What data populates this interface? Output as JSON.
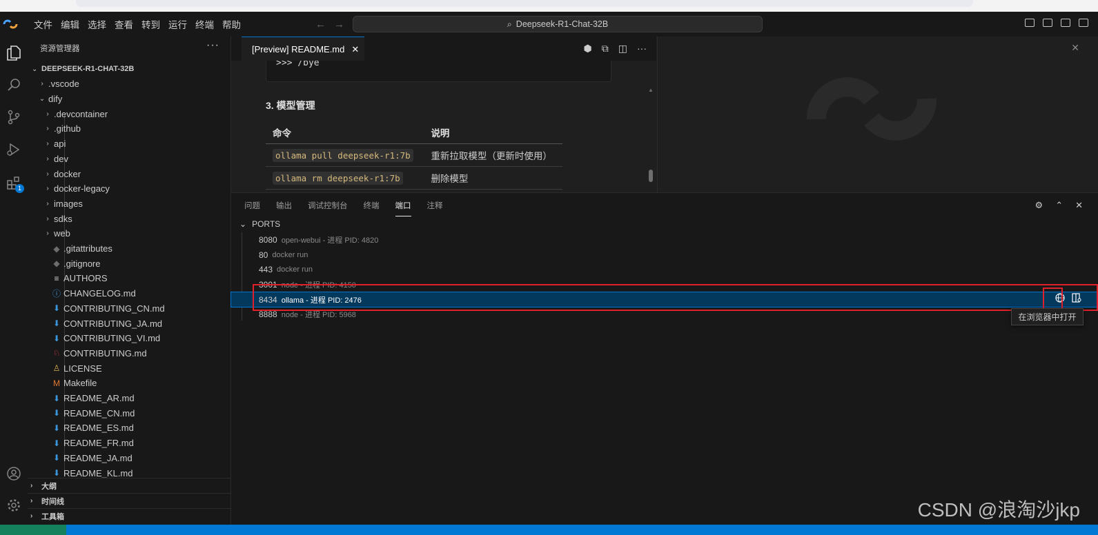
{
  "titlebar": {
    "menus": [
      "文件",
      "编辑",
      "选择",
      "查看",
      "转到",
      "运行",
      "终端",
      "帮助"
    ],
    "search_text": "Deepseek-R1-Chat-32B"
  },
  "activitybar": {
    "items": [
      "explorer-icon",
      "search-icon",
      "source-control-icon",
      "run-debug-icon",
      "extensions-icon"
    ],
    "extensions_badge": "1",
    "bottom": [
      "account-icon",
      "settings-gear-icon"
    ]
  },
  "sidebar": {
    "title": "资源管理器",
    "more": "···",
    "workspace": "DEEPSEEK-R1-CHAT-32B",
    "tree": [
      {
        "label": ".vscode",
        "chev": "›",
        "indent": 1,
        "icon": ""
      },
      {
        "label": "dify",
        "chev": "⌄",
        "indent": 1,
        "icon": ""
      },
      {
        "label": ".devcontainer",
        "chev": "›",
        "indent": 2,
        "icon": ""
      },
      {
        "label": ".github",
        "chev": "›",
        "indent": 2,
        "icon": ""
      },
      {
        "label": "api",
        "chev": "›",
        "indent": 2,
        "icon": ""
      },
      {
        "label": "dev",
        "chev": "›",
        "indent": 2,
        "icon": ""
      },
      {
        "label": "docker",
        "chev": "›",
        "indent": 2,
        "icon": ""
      },
      {
        "label": "docker-legacy",
        "chev": "›",
        "indent": 2,
        "icon": ""
      },
      {
        "label": "images",
        "chev": "›",
        "indent": 2,
        "icon": ""
      },
      {
        "label": "sdks",
        "chev": "›",
        "indent": 2,
        "icon": ""
      },
      {
        "label": "web",
        "chev": "›",
        "indent": 2,
        "icon": ""
      },
      {
        "label": ".gitattributes",
        "chev": "",
        "indent": 2,
        "icon": "◆",
        "color": "#6d6d6d"
      },
      {
        "label": ".gitignore",
        "chev": "",
        "indent": 2,
        "icon": "◆",
        "color": "#6d6d6d"
      },
      {
        "label": "AUTHORS",
        "chev": "",
        "indent": 2,
        "icon": "≡",
        "color": "#cccccc"
      },
      {
        "label": "CHANGELOG.md",
        "chev": "",
        "indent": 2,
        "icon": "ⓘ",
        "color": "#3a96dd"
      },
      {
        "label": "CONTRIBUTING_CN.md",
        "chev": "",
        "indent": 2,
        "icon": "⬇",
        "color": "#3a96dd"
      },
      {
        "label": "CONTRIBUTING_JA.md",
        "chev": "",
        "indent": 2,
        "icon": "⬇",
        "color": "#3a96dd"
      },
      {
        "label": "CONTRIBUTING_VI.md",
        "chev": "",
        "indent": 2,
        "icon": "⬇",
        "color": "#3a96dd"
      },
      {
        "label": "CONTRIBUTING.md",
        "chev": "",
        "indent": 2,
        "icon": "♘",
        "color": "#e0434b"
      },
      {
        "label": "LICENSE",
        "chev": "",
        "indent": 2,
        "icon": "♙",
        "color": "#d8b04c"
      },
      {
        "label": "Makefile",
        "chev": "",
        "indent": 2,
        "icon": "M",
        "color": "#e37933"
      },
      {
        "label": "README_AR.md",
        "chev": "",
        "indent": 2,
        "icon": "⬇",
        "color": "#3a96dd"
      },
      {
        "label": "README_CN.md",
        "chev": "",
        "indent": 2,
        "icon": "⬇",
        "color": "#3a96dd"
      },
      {
        "label": "README_ES.md",
        "chev": "",
        "indent": 2,
        "icon": "⬇",
        "color": "#3a96dd"
      },
      {
        "label": "README_FR.md",
        "chev": "",
        "indent": 2,
        "icon": "⬇",
        "color": "#3a96dd"
      },
      {
        "label": "README_JA.md",
        "chev": "",
        "indent": 2,
        "icon": "⬇",
        "color": "#3a96dd"
      },
      {
        "label": "README_KL.md",
        "chev": "",
        "indent": 2,
        "icon": "⬇",
        "color": "#3a96dd"
      }
    ],
    "sections": [
      "大纲",
      "时间线",
      "工具箱"
    ]
  },
  "editor": {
    "tab_label": "[Preview] README.md",
    "code_line": ">>> /bye",
    "section_title": "3. 模型管理",
    "table": {
      "headers": [
        "命令",
        "说明"
      ],
      "rows": [
        [
          "ollama pull deepseek-r1:7b",
          "重新拉取模型（更新时使用）"
        ],
        [
          "ollama rm deepseek-r1:7b",
          "删除模型"
        ]
      ]
    }
  },
  "panel": {
    "tabs": [
      "问题",
      "输出",
      "调试控制台",
      "终端",
      "端口",
      "注释"
    ],
    "active_tab": "端口",
    "ports_header": "PORTS",
    "ports": [
      {
        "port": "8080",
        "desc": "open-webui - 进程 PID: 4820"
      },
      {
        "port": "80",
        "desc": "docker run"
      },
      {
        "port": "443",
        "desc": "docker run"
      },
      {
        "port": "3001",
        "desc": "node - 进程 PID: 4150"
      },
      {
        "port": "8434",
        "desc": "ollama - 进程 PID: 2476"
      },
      {
        "port": "8888",
        "desc": "node - 进程 PID: 5968"
      }
    ],
    "selected_port": "8434",
    "tooltip": "在浏览器中打开"
  },
  "watermark": "CSDN @浪淘沙jkp",
  "colors": {
    "accent": "#0078d4",
    "selection": "#04395e",
    "highlight_box": "#e0202a",
    "inline_code": "#d7ba7d"
  }
}
